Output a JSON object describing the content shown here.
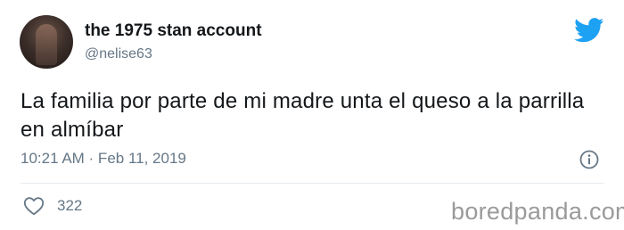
{
  "tweet": {
    "display_name": "the 1975 stan account",
    "handle": "@nelise63",
    "text": "La familia por parte de mi madre unta el queso a la parrilla en almíbar",
    "timestamp": "10:21 AM · Feb 11, 2019",
    "likes": "322"
  },
  "icons": {
    "brand": "twitter-bird-icon",
    "info": "info-icon",
    "like": "heart-icon"
  },
  "watermark": "boredpanda.com",
  "colors": {
    "twitter_blue": "#1da1f2",
    "secondary_text": "#657786",
    "primary_text": "#14171a"
  }
}
